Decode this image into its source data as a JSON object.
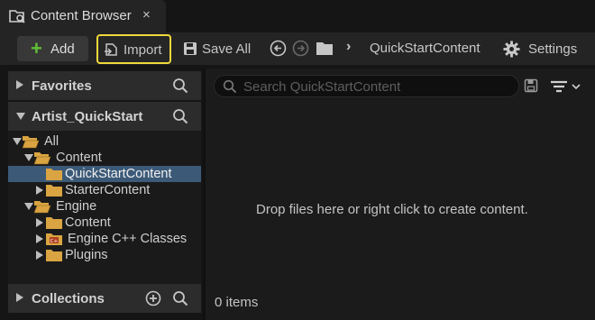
{
  "tab": {
    "title": "Content Browser",
    "close": "×",
    "icon": "content-browser-icon"
  },
  "toolbar": {
    "add_label": "Add",
    "import_label": "Import",
    "save_all_label": "Save All",
    "breadcrumb": "QuickStartContent",
    "settings_label": "Settings",
    "accent_highlight": "#f1d83a",
    "add_color": "#5fbf36"
  },
  "sections": {
    "favorites": "Favorites",
    "project": "Artist_QuickStart",
    "collections": "Collections"
  },
  "tree": [
    {
      "label": "All",
      "kind": "folder-open",
      "arrow": "down",
      "selected": false
    },
    {
      "label": "Content",
      "kind": "folder-open",
      "arrow": "down",
      "selected": false
    },
    {
      "label": "QuickStartContent",
      "kind": "folder",
      "arrow": "none",
      "selected": true
    },
    {
      "label": "StarterContent",
      "kind": "folder",
      "arrow": "right",
      "selected": false
    },
    {
      "label": "Engine",
      "kind": "folder-open",
      "arrow": "down",
      "selected": false
    },
    {
      "label": "Content",
      "kind": "folder",
      "arrow": "right",
      "selected": false
    },
    {
      "label": "Engine C++ Classes",
      "kind": "cpp-folder",
      "arrow": "right",
      "selected": false
    },
    {
      "label": "Plugins",
      "kind": "folder",
      "arrow": "right",
      "selected": false
    }
  ],
  "search": {
    "placeholder": "Search QuickStartContent",
    "value": ""
  },
  "content": {
    "empty_message": "Drop files here or right click to create content.",
    "item_count": "0 items"
  },
  "colors": {
    "selection": "#3c5a78",
    "folder": "#d9a441"
  }
}
